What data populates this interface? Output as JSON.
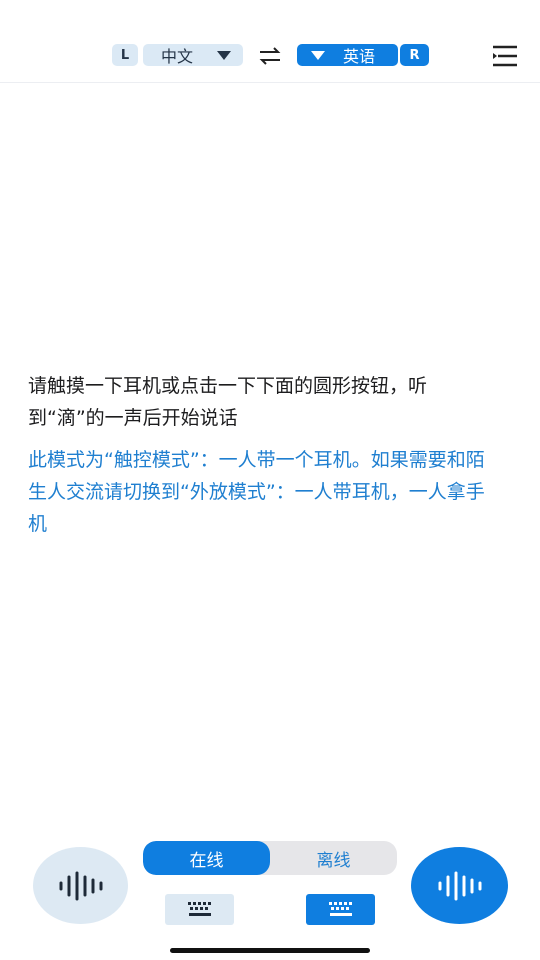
{
  "header": {
    "left_tag": "L",
    "source_language": "中文",
    "target_language": "英语",
    "right_tag": "R"
  },
  "main": {
    "prompt": "请触摸一下耳机或点击一下下面的圆形按钮，听到“滴”的一声后开始说话",
    "note": "此模式为“触控模式”：一人带一个耳机。如果需要和陌生人交流请切换到“外放模式”：一人带耳机，一人拿手机"
  },
  "bottom": {
    "mode_online": "在线",
    "mode_offline": "离线",
    "selected_mode": "在线"
  },
  "icons": {
    "swap": "swap-arrows-icon",
    "menu": "menu-icon",
    "mic": "voice-wave-icon",
    "keyboard": "keyboard-icon"
  },
  "colors": {
    "accent": "#0f7ee0",
    "accent_light": "#dbe9f5",
    "note_text": "#1f7fd0"
  }
}
